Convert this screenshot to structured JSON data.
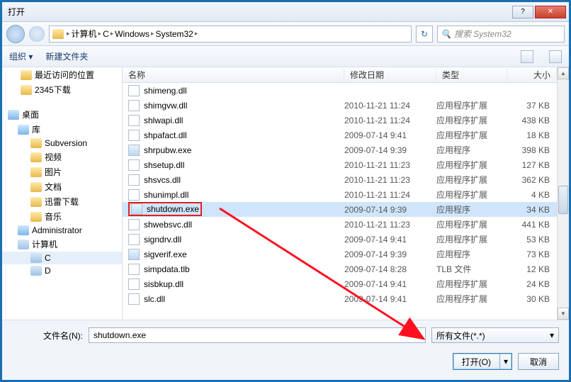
{
  "window": {
    "title": "打开"
  },
  "breadcrumb": [
    "计算机",
    "C",
    "Windows",
    "System32"
  ],
  "search": {
    "placeholder": "搜索 System32"
  },
  "toolbar": {
    "organize": "组织 ▾",
    "newfolder": "新建文件夹"
  },
  "tree": {
    "favorites": {
      "recent": "最近访问的位置",
      "dl2345": "2345下载"
    },
    "desktop": "桌面",
    "libraries": "库",
    "lib_items": [
      "Subversion",
      "视频",
      "图片",
      "文档",
      "迅雷下载",
      "音乐"
    ],
    "admin": "Administrator",
    "computer": "计算机",
    "drives": [
      "C",
      "D"
    ]
  },
  "columns": {
    "name": "名称",
    "date": "修改日期",
    "type": "类型",
    "size": "大小"
  },
  "files": [
    {
      "name": "shimeng.dll",
      "date": "",
      "type": "",
      "size": ""
    },
    {
      "name": "shimgvw.dll",
      "date": "2010-11-21 11:24",
      "type": "应用程序扩展",
      "size": "37 KB"
    },
    {
      "name": "shlwapi.dll",
      "date": "2010-11-21 11:24",
      "type": "应用程序扩展",
      "size": "438 KB"
    },
    {
      "name": "shpafact.dll",
      "date": "2009-07-14 9:41",
      "type": "应用程序扩展",
      "size": "18 KB"
    },
    {
      "name": "shrpubw.exe",
      "date": "2009-07-14 9:39",
      "type": "应用程序",
      "size": "398 KB",
      "exe": true
    },
    {
      "name": "shsetup.dll",
      "date": "2010-11-21 11:23",
      "type": "应用程序扩展",
      "size": "127 KB"
    },
    {
      "name": "shsvcs.dll",
      "date": "2010-11-21 11:23",
      "type": "应用程序扩展",
      "size": "362 KB"
    },
    {
      "name": "shunimpl.dll",
      "date": "2010-11-21 11:24",
      "type": "应用程序扩展",
      "size": "4 KB"
    },
    {
      "name": "shutdown.exe",
      "date": "2009-07-14 9:39",
      "type": "应用程序",
      "size": "34 KB",
      "exe": true,
      "selected": true
    },
    {
      "name": "shwebsvc.dll",
      "date": "2010-11-21 11:23",
      "type": "应用程序扩展",
      "size": "441 KB"
    },
    {
      "name": "signdrv.dll",
      "date": "2009-07-14 9:41",
      "type": "应用程序扩展",
      "size": "53 KB"
    },
    {
      "name": "sigverif.exe",
      "date": "2009-07-14 9:39",
      "type": "应用程序",
      "size": "73 KB",
      "exe": true
    },
    {
      "name": "simpdata.tlb",
      "date": "2009-07-14 8:28",
      "type": "TLB 文件",
      "size": "12 KB"
    },
    {
      "name": "sisbkup.dll",
      "date": "2009-07-14 9:41",
      "type": "应用程序扩展",
      "size": "24 KB"
    },
    {
      "name": "slc.dll",
      "date": "2009-07-14 9:41",
      "type": "应用程序扩展",
      "size": "30 KB"
    }
  ],
  "footer": {
    "filename_label": "文件名(N):",
    "filename_value": "shutdown.exe",
    "filter": "所有文件(*.*)",
    "open": "打开(O)",
    "cancel": "取消"
  }
}
